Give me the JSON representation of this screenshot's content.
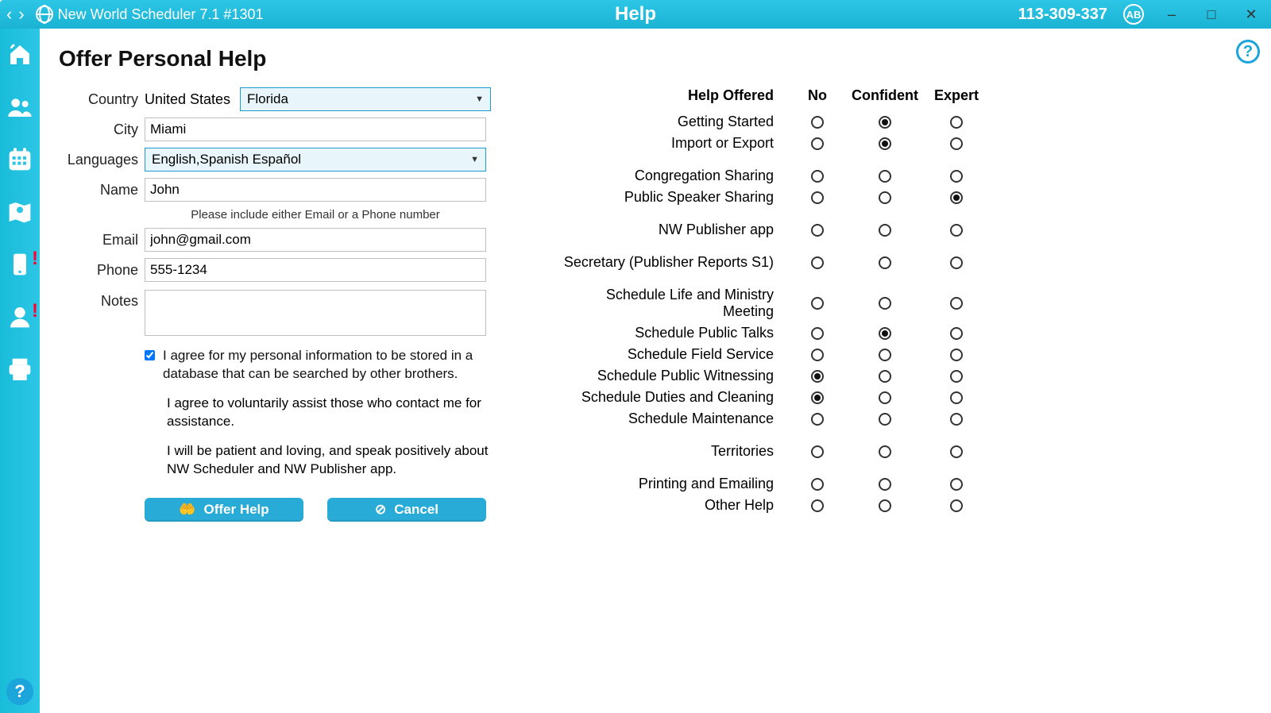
{
  "titlebar": {
    "app_name": "New World Scheduler 7.1 #1301",
    "center_title": "Help",
    "license": "113-309-337",
    "user_badge": "AB"
  },
  "sidebar": {
    "icons": [
      "home",
      "people",
      "calendar",
      "map",
      "device",
      "person",
      "printer"
    ]
  },
  "page": {
    "title": "Offer Personal Help"
  },
  "form": {
    "labels": {
      "country": "Country",
      "city": "City",
      "languages": "Languages",
      "name": "Name",
      "email": "Email",
      "phone": "Phone",
      "notes": "Notes"
    },
    "country_value": "United States",
    "state_dropdown": "Florida",
    "city_value": "Miami",
    "languages_dropdown": "English,Spanish Español",
    "name_value": "John",
    "contact_hint": "Please include either Email or a Phone number",
    "email_value": "john@gmail.com",
    "phone_value": "555-1234",
    "notes_value": "",
    "agree_checked": true,
    "agree1": "I agree for my personal information to be stored in a database that can be searched by other brothers.",
    "agree2": "I agree to voluntarily assist those who contact me for assistance.",
    "agree3": "I will be patient and loving, and speak positively about NW Scheduler and NW Publisher app.",
    "offer_btn": "Offer Help",
    "cancel_btn": "Cancel"
  },
  "skills": {
    "header": {
      "col1": "Help Offered",
      "col2": "No",
      "col3": "Confident",
      "col4": "Expert"
    },
    "rows": [
      {
        "label": "Getting Started",
        "sel": "confident",
        "gap": false
      },
      {
        "label": "Import or Export",
        "sel": "confident",
        "gap": true
      },
      {
        "label": "Congregation Sharing",
        "sel": "",
        "gap": false
      },
      {
        "label": "Public Speaker Sharing",
        "sel": "expert",
        "gap": true
      },
      {
        "label": "NW Publisher app",
        "sel": "",
        "gap": true
      },
      {
        "label": "Secretary (Publisher Reports S1)",
        "sel": "",
        "gap": true
      },
      {
        "label": "Schedule Life and Ministry Meeting",
        "sel": "",
        "gap": false
      },
      {
        "label": "Schedule Public Talks",
        "sel": "confident",
        "gap": false
      },
      {
        "label": "Schedule Field Service",
        "sel": "",
        "gap": false
      },
      {
        "label": "Schedule Public Witnessing",
        "sel": "no",
        "gap": false
      },
      {
        "label": "Schedule Duties and Cleaning",
        "sel": "no",
        "gap": false
      },
      {
        "label": "Schedule Maintenance",
        "sel": "",
        "gap": true
      },
      {
        "label": "Territories",
        "sel": "",
        "gap": true
      },
      {
        "label": "Printing and Emailing",
        "sel": "",
        "gap": false
      },
      {
        "label": "Other Help",
        "sel": "",
        "gap": false
      }
    ]
  }
}
